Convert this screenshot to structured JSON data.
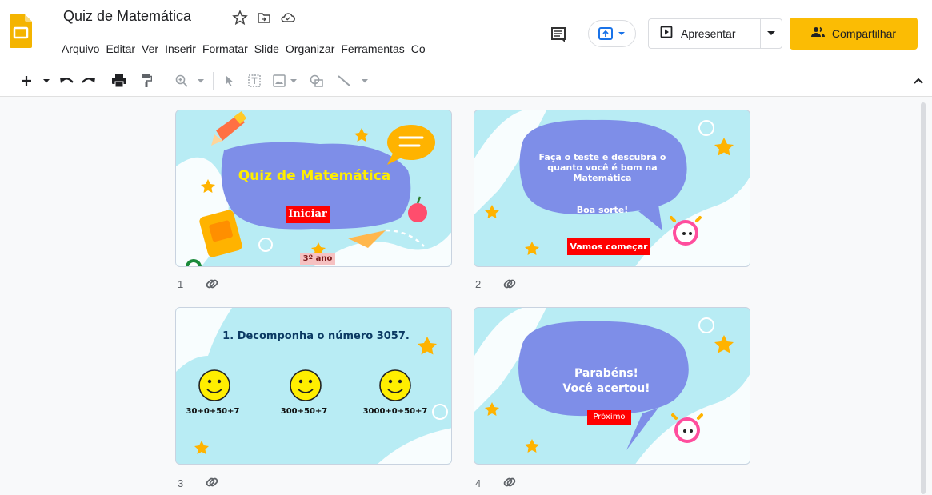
{
  "app": {
    "title": "Quiz de Matemática",
    "menu": [
      "Arquivo",
      "Editar",
      "Ver",
      "Inserir",
      "Formatar",
      "Slide",
      "Organizar",
      "Ferramentas",
      "Co"
    ],
    "present_label": "Apresentar",
    "share_label": "Compartilhar",
    "brand_color": "#fbbc04"
  },
  "slides": [
    {
      "number": "1",
      "title": "Quiz de Matemática",
      "button": "Iniciar",
      "grade": "3º ano"
    },
    {
      "number": "2",
      "text1": "Faça o teste e descubra o",
      "text2": "quanto você é bom na",
      "text3": "Matemática",
      "text4": "Boa sorte!",
      "button": "Vamos começar"
    },
    {
      "number": "3",
      "question": "1.  Decomponha o número 3057.",
      "options": [
        "30+0+50+7",
        "300+50+7",
        "3000+0+50+7"
      ]
    },
    {
      "number": "4",
      "text1": "Parabéns!",
      "text2": "Você acertou!",
      "button": "Próximo"
    }
  ]
}
